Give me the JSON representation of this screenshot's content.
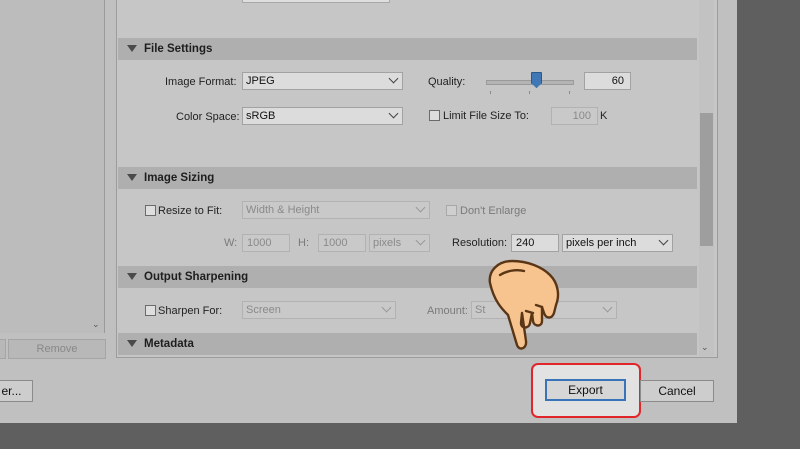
{
  "left": {
    "remove_label": "Remove",
    "truncated_button_label": "er..."
  },
  "file_settings": {
    "header": "File Settings",
    "image_format_label": "Image Format:",
    "image_format_value": "JPEG",
    "color_space_label": "Color Space:",
    "color_space_value": "sRGB",
    "quality_label": "Quality:",
    "quality_value": "60",
    "quality_fraction": 0.6,
    "limit_label": "Limit File Size To:",
    "limit_value": "100",
    "limit_unit": "K"
  },
  "image_sizing": {
    "header": "Image Sizing",
    "resize_label": "Resize to Fit:",
    "resize_value": "Width & Height",
    "dont_enlarge_label": "Don't Enlarge",
    "w_label": "W:",
    "w_value": "1000",
    "h_label": "H:",
    "h_value": "1000",
    "unit_value": "pixels",
    "resolution_label": "Resolution:",
    "resolution_value": "240",
    "resolution_unit": "pixels per inch"
  },
  "output_sharpening": {
    "header": "Output Sharpening",
    "sharpen_label": "Sharpen For:",
    "sharpen_value": "Screen",
    "amount_label": "Amount:",
    "amount_value": "St"
  },
  "metadata": {
    "header": "Metadata"
  },
  "footer": {
    "export_label": "Export",
    "cancel_label": "Cancel"
  },
  "colors": {
    "highlight": "#e0252b",
    "accent": "#3a74b8",
    "hand": "#f7c48f"
  }
}
